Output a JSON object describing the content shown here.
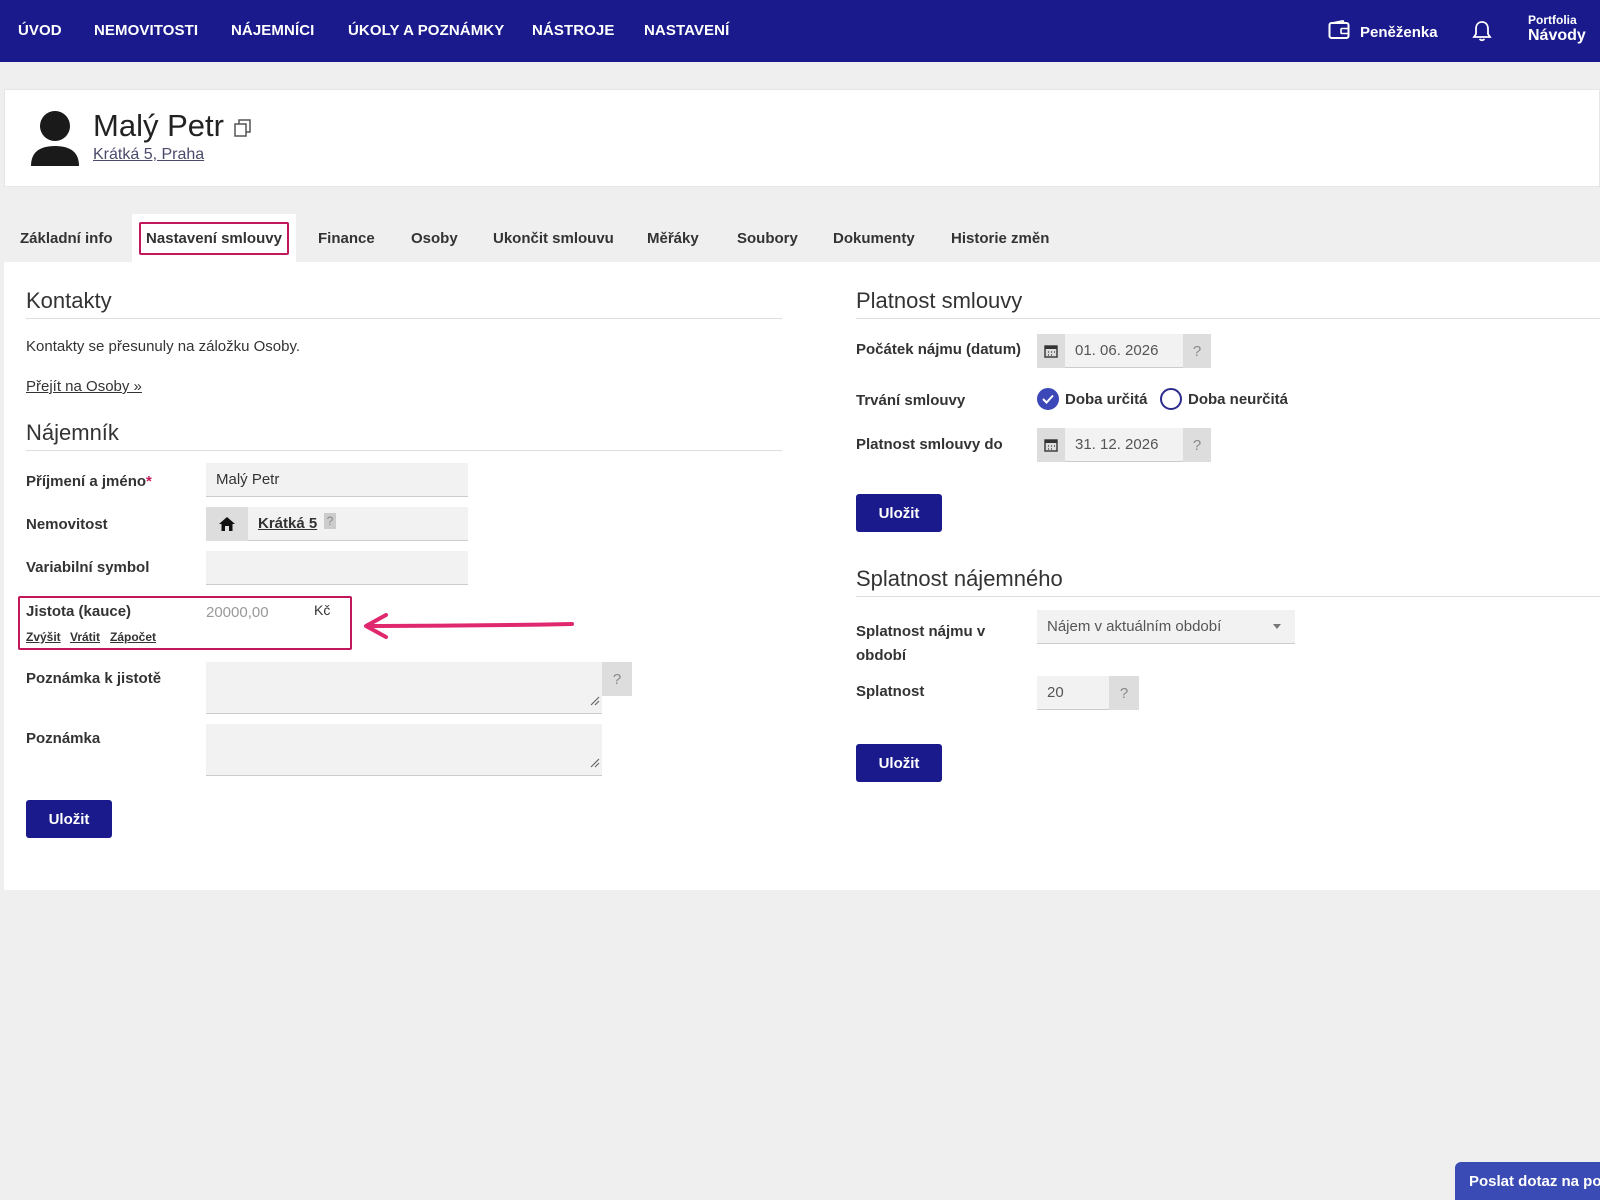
{
  "nav": {
    "items": [
      "ÚVOD",
      "NEMOVITOSTI",
      "NÁJEMNÍCI",
      "ÚKOLY A POZNÁMKY",
      "NÁSTROJE",
      "NASTAVENÍ"
    ],
    "wallet_label": "Peněženka",
    "portfolio_small": "Portfolia",
    "portfolio_big": "Návody"
  },
  "header": {
    "name": "Malý Petr",
    "address": "Krátká 5, Praha"
  },
  "tabs": [
    "Základní info",
    "Nastavení smlouvy",
    "Finance",
    "Osoby",
    "Ukončit smlouvu",
    "Měřáky",
    "Soubory",
    "Dokumenty",
    "Historie změn"
  ],
  "active_tab_index": 1,
  "contacts": {
    "title": "Kontakty",
    "text": "Kontakty se přesunuly na záložku Osoby.",
    "link": "Přejít na Osoby »"
  },
  "tenant": {
    "title": "Nájemník",
    "name_label": "Příjmení a jméno",
    "required_mark": "*",
    "name_value": "Malý Petr",
    "property_label": "Nemovitost",
    "property_value": "Krátká 5",
    "vs_label": "Variabilní symbol",
    "vs_value": "",
    "deposit_label": "Jistota (kauce)",
    "deposit_placeholder": "20000,00",
    "deposit_currency": "Kč",
    "deposit_actions": [
      "Zvýšit",
      "Vrátit",
      "Zápočet"
    ],
    "deposit_note_label": "Poznámka k jistotě",
    "note_label": "Poznámka",
    "help": "?",
    "save": "Uložit"
  },
  "validity": {
    "title": "Platnost smlouvy",
    "start_label": "Počátek nájmu (datum)",
    "start_value": "01. 06. 2026",
    "duration_label": "Trvání smlouvy",
    "option_fixed": "Doba určitá",
    "option_indefinite": "Doba neurčitá",
    "selected": "Doba určitá",
    "end_label": "Platnost smlouvy do",
    "end_value": "31. 12. 2026",
    "help": "?",
    "save": "Uložit"
  },
  "due": {
    "title": "Splatnost nájemného",
    "period_label_line1": "Splatnost nájmu v",
    "period_label_line2": "období",
    "period_value": "Nájem v aktuálním období",
    "due_label": "Splatnost",
    "due_value": "20",
    "help": "?",
    "save": "Uložit"
  },
  "chat_button": "Poslat dotaz na podporu",
  "colors": {
    "nav_bg": "#1a1a8c",
    "highlight": "#c2185b",
    "button": "#1a1a8c"
  }
}
